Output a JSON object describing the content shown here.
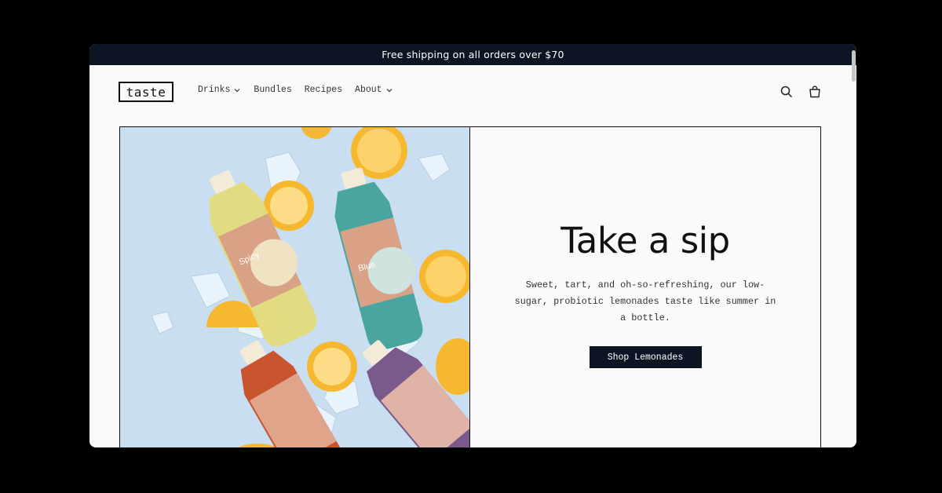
{
  "announcement": {
    "text": "Free shipping on all orders over $70"
  },
  "header": {
    "logo": "taste",
    "nav": [
      {
        "label": "Drinks",
        "has_dropdown": true
      },
      {
        "label": "Bundles",
        "has_dropdown": false
      },
      {
        "label": "Recipes",
        "has_dropdown": false
      },
      {
        "label": "About",
        "has_dropdown": true
      }
    ],
    "icons": [
      "search-icon",
      "cart-icon"
    ]
  },
  "hero": {
    "title": "Take a sip",
    "subtitle": "Sweet, tart, and oh-so-refreshing, our low-sugar, probiotic lemonades taste like summer in a bottle.",
    "cta_label": "Shop Lemonades",
    "image_labels": [
      "Spicy",
      "Blue"
    ]
  },
  "colors": {
    "dark": "#0d1524",
    "page_bg": "#fafafa",
    "image_bg": "#c9def0",
    "lemon": "#f5b82e"
  }
}
